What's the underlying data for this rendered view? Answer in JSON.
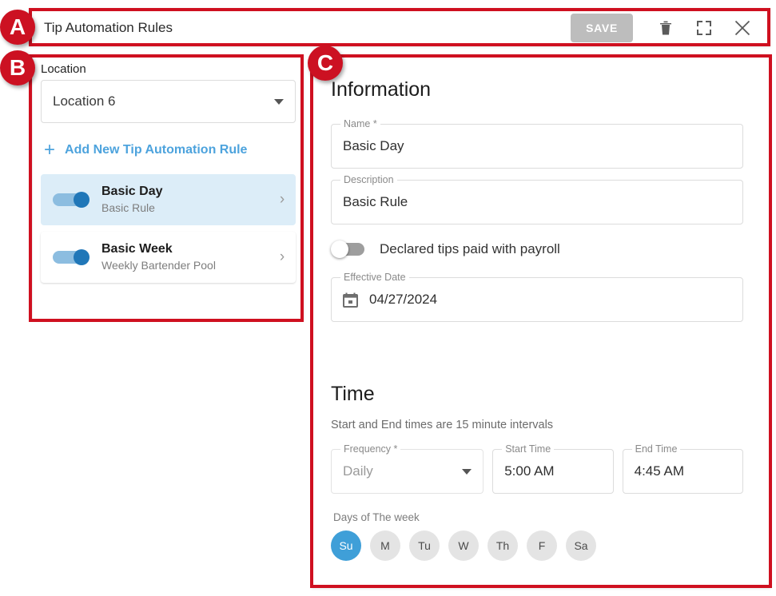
{
  "header": {
    "title": "Tip Automation Rules",
    "save_label": "SAVE",
    "icons": {
      "delete": "trash-icon",
      "fullscreen": "fullscreen-icon",
      "close": "close-icon"
    }
  },
  "annotations": [
    {
      "letter": "A"
    },
    {
      "letter": "B"
    },
    {
      "letter": "C"
    }
  ],
  "sidebar": {
    "location_label": "Location",
    "location_value": "Location 6",
    "add_rule_label": "Add New Tip Automation Rule",
    "add_rule_icon": "plus-icon",
    "rules": [
      {
        "title": "Basic Day",
        "subtitle": "Basic Rule",
        "enabled": true,
        "selected": true,
        "chevron": "chevron-right-icon"
      },
      {
        "title": "Basic Week",
        "subtitle": "Weekly Bartender Pool",
        "enabled": true,
        "selected": false,
        "chevron": "chevron-right-icon"
      }
    ]
  },
  "information": {
    "section_title": "Information",
    "name": {
      "label": "Name *",
      "value": "Basic Day"
    },
    "description": {
      "label": "Description",
      "value": "Basic Rule"
    },
    "declared_tips": {
      "label": "Declared tips paid with payroll",
      "enabled": false
    },
    "effective_date": {
      "label": "Effective Date",
      "value": "04/27/2024",
      "icon": "calendar-icon"
    }
  },
  "time": {
    "section_title": "Time",
    "note": "Start and End times are 15 minute intervals",
    "frequency": {
      "label": "Frequency *",
      "value": "Daily",
      "disabled": true
    },
    "start_time": {
      "label": "Start Time",
      "value": "5:00 AM"
    },
    "end_time": {
      "label": "End Time",
      "value": "4:45 AM"
    },
    "days_label": "Days of The week",
    "days": [
      {
        "label": "Su",
        "selected": true
      },
      {
        "label": "M",
        "selected": false
      },
      {
        "label": "Tu",
        "selected": false
      },
      {
        "label": "W",
        "selected": false
      },
      {
        "label": "Th",
        "selected": false
      },
      {
        "label": "F",
        "selected": false
      },
      {
        "label": "Sa",
        "selected": false
      }
    ]
  },
  "colors": {
    "annotation_red": "#cc1122",
    "primary_blue": "#2077b8",
    "link_blue": "#4da3dd",
    "chip_active_blue": "#3f9fd8",
    "selected_row_bg": "#dcedf8",
    "save_disabled": "#bdbdbd"
  }
}
